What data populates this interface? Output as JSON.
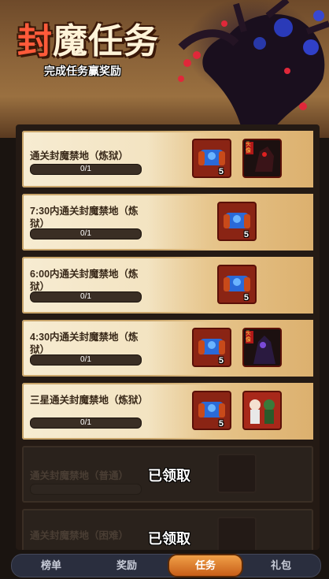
{
  "banner": {
    "title_first": "封",
    "title_rest": "魔任务",
    "subtitle": "完成任务赢奖励"
  },
  "tasks": [
    {
      "label": "通关封魔禁地（炼狱）",
      "progress": "0/1",
      "rewards": [
        {
          "icon": "scroll-icon",
          "count": "5"
        },
        {
          "icon": "dark-hero-icon",
          "tag": "头像"
        }
      ]
    },
    {
      "label": "7:30内通关封魔禁地（炼狱）",
      "progress": "0/1",
      "rewards": [
        {
          "icon": "scroll-icon",
          "count": "5"
        }
      ]
    },
    {
      "label": "6:00内通关封魔禁地（炼狱）",
      "progress": "0/1",
      "rewards": [
        {
          "icon": "scroll-icon",
          "count": "5"
        }
      ]
    },
    {
      "label": "4:30内通关封魔禁地（炼狱）",
      "progress": "0/1",
      "rewards": [
        {
          "icon": "scroll-icon",
          "count": "5"
        },
        {
          "icon": "shadow-hero-icon",
          "tag": "头像"
        }
      ]
    },
    {
      "label": "三星通关封魔禁地（炼狱）",
      "progress": "0/1",
      "rewards": [
        {
          "icon": "scroll-icon",
          "count": "5"
        },
        {
          "icon": "duo-hero-icon"
        }
      ]
    }
  ],
  "claimed_tasks": [
    {
      "label": "通关封魔禁地（普通）",
      "status": "已领取"
    },
    {
      "label": "通关封魔禁地（困难）",
      "status": "已领取"
    }
  ],
  "tabs": [
    {
      "label": "榜单",
      "active": false
    },
    {
      "label": "奖励",
      "active": false
    },
    {
      "label": "任务",
      "active": true
    },
    {
      "label": "礼包",
      "active": false
    }
  ],
  "colors": {
    "accent": "#e07a2a",
    "panel": "#241a14",
    "card": "#f2e2bf",
    "reward_bg": "#8a2414"
  }
}
